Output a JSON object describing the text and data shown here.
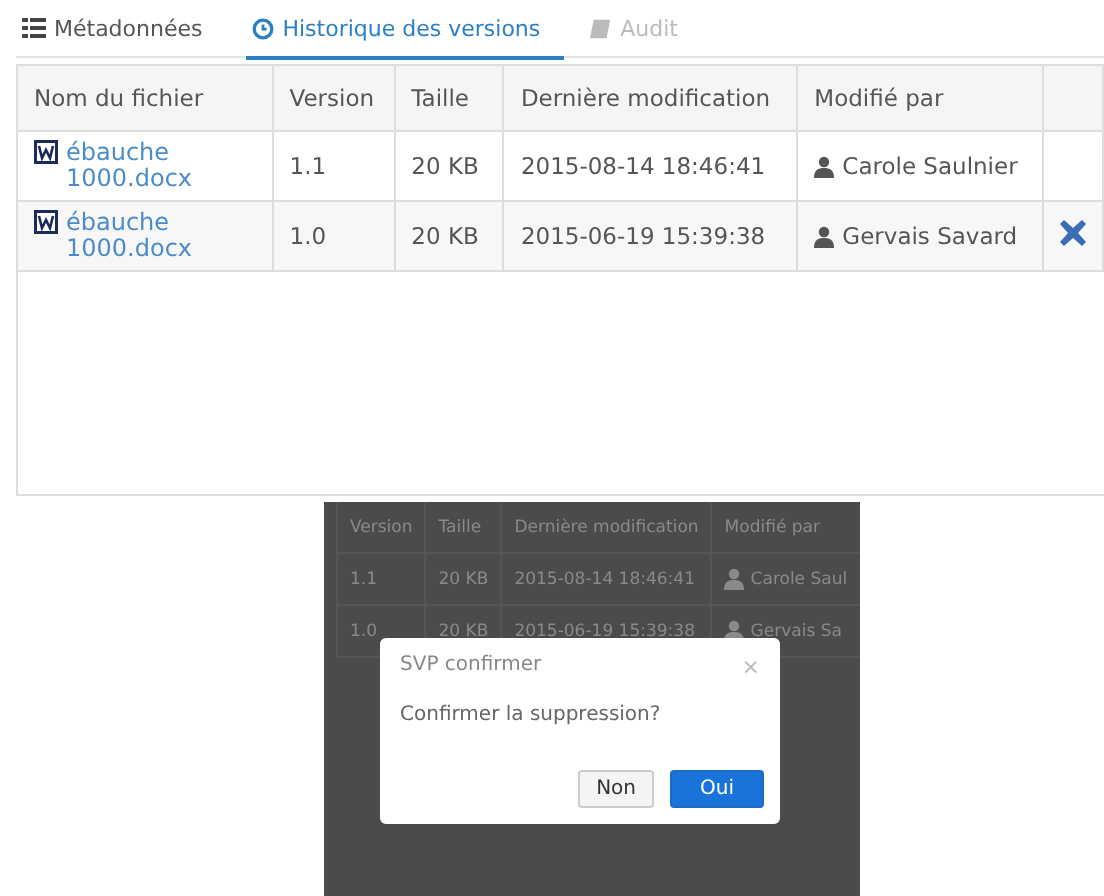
{
  "tabs": [
    {
      "label": "Métadonnées",
      "selected": false,
      "disabled": false
    },
    {
      "label": "Historique des versions",
      "selected": true,
      "disabled": false
    },
    {
      "label": "Audit",
      "selected": false,
      "disabled": true
    }
  ],
  "table": {
    "columns": [
      "Nom du fichier",
      "Version",
      "Taille",
      "Dernière modification",
      "Modifié par"
    ],
    "rows": [
      {
        "file": "ébauche 1000.docx",
        "version": "1.1",
        "size": "20 KB",
        "modified": "2015-08-14 18:46:41",
        "author": "Carole Saulnier",
        "deletable": false
      },
      {
        "file": "ébauche 1000.docx",
        "version": "1.0",
        "size": "20 KB",
        "modified": "2015-06-19 15:39:38",
        "author": "Gervais Savard",
        "deletable": true
      }
    ]
  },
  "preview": {
    "columns": [
      "Version",
      "Taille",
      "Dernière modification",
      "Modifié par"
    ],
    "rows": [
      {
        "version": "1.1",
        "size": "20 KB",
        "modified": "2015-08-14 18:46:41",
        "author": "Carole Saul"
      },
      {
        "version": "1.0",
        "size": "20 KB",
        "modified": "2015-06-19 15:39:38",
        "author": "Gervais Sa"
      }
    ],
    "dialog": {
      "title": "SVP confirmer",
      "close": "×",
      "message": "Confirmer la suppression?",
      "buttons": [
        {
          "label": "Non",
          "kind": "secondary"
        },
        {
          "label": "Oui",
          "kind": "primary"
        }
      ]
    }
  }
}
